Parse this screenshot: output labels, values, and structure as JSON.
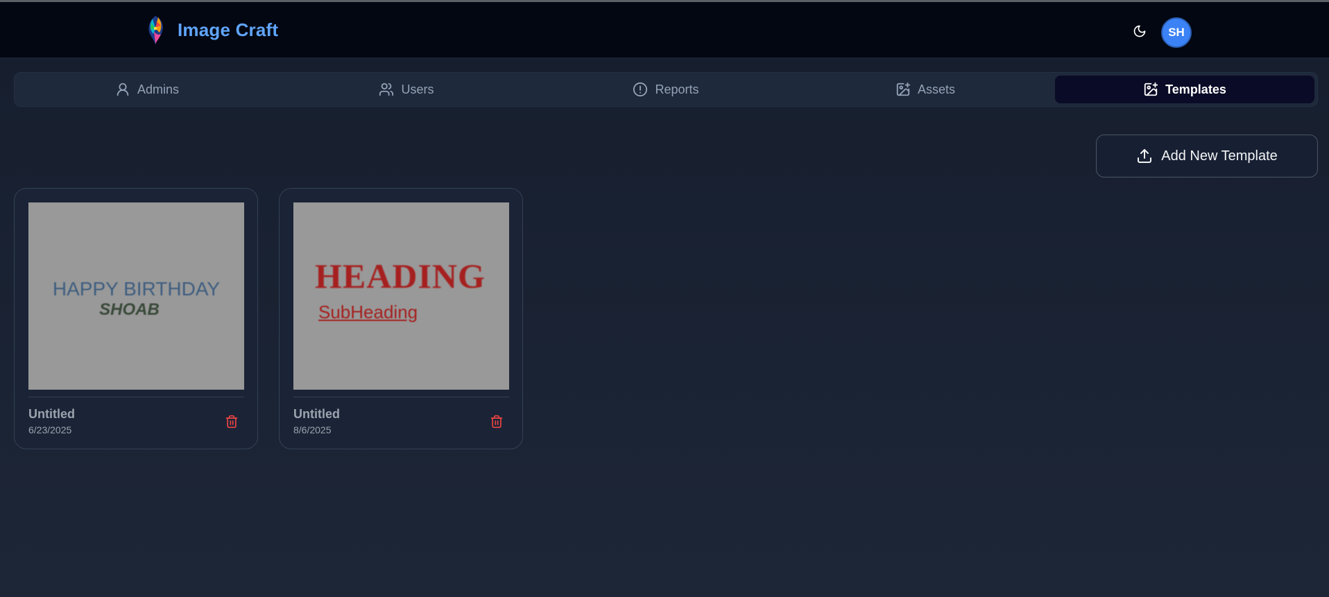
{
  "header": {
    "brand": "Image Craft",
    "avatar_initials": "SH",
    "theme_icon": "moon-icon"
  },
  "tabs": [
    {
      "label": "Admins",
      "icon": "user-icon",
      "active": false
    },
    {
      "label": "Users",
      "icon": "users-icon",
      "active": false
    },
    {
      "label": "Reports",
      "icon": "alert-circle-icon",
      "active": false
    },
    {
      "label": "Assets",
      "icon": "image-plus-icon",
      "active": false
    },
    {
      "label": "Templates",
      "icon": "image-plus-icon",
      "active": true
    }
  ],
  "actions": {
    "add_template_label": "Add New Template"
  },
  "templates": [
    {
      "name": "Untitled",
      "date": "6/23/2025",
      "preview": {
        "line1": "HAPPY BIRTHDAY",
        "line2": "SHOAB"
      }
    },
    {
      "name": "Untitled",
      "date": "8/6/2025",
      "preview": {
        "line1": "HEADING",
        "line2": "SubHeading"
      }
    }
  ],
  "colors": {
    "accent": "#60a5fa",
    "avatar_bg": "#3b82f6",
    "active_tab_bg": "#0a0b26",
    "danger": "#ef4444"
  }
}
